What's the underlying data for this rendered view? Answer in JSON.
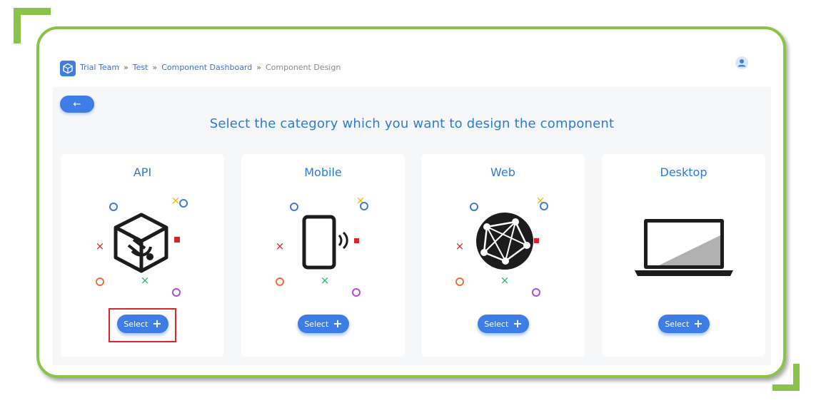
{
  "breadcrumb": {
    "items": [
      "Trial Team",
      "Test",
      "Component Dashboard",
      "Component Design"
    ],
    "separator": "»"
  },
  "back_button": {
    "label": "←"
  },
  "headline": "Select the category which you want to design the component",
  "cards": [
    {
      "title": "API",
      "button_label": "Select",
      "icon": "api-cube-icon"
    },
    {
      "title": "Mobile",
      "button_label": "Select",
      "icon": "mobile-phone-icon"
    },
    {
      "title": "Web",
      "button_label": "Select",
      "icon": "globe-icon"
    },
    {
      "title": "Desktop",
      "button_label": "Select",
      "icon": "laptop-icon"
    }
  ],
  "colors": {
    "accent": "#3d7de5",
    "frame": "#8bc34a",
    "highlight": "#d9262c",
    "title": "#2e7ad8"
  }
}
